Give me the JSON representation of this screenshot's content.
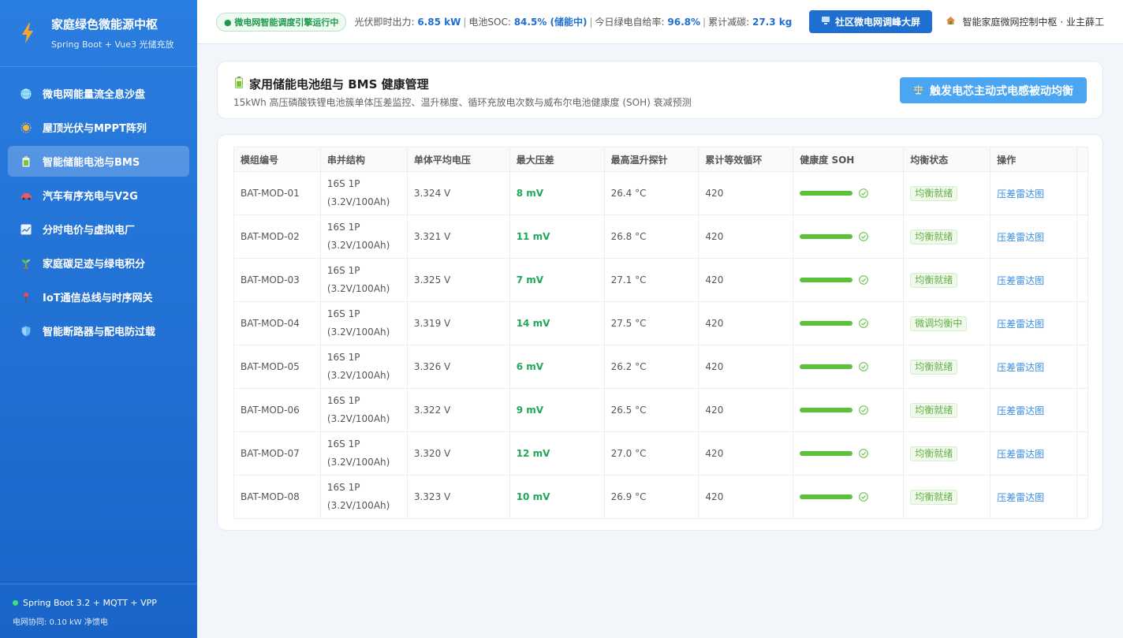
{
  "brand": {
    "title": "家庭绿色微能源中枢",
    "subtitle": "Spring Boot + Vue3 光储充放"
  },
  "nav": [
    {
      "label": "微电网能量流全息沙盘",
      "icon": "globe-icon",
      "active": false
    },
    {
      "label": "屋顶光伏与MPPT阵列",
      "icon": "sun-icon",
      "active": false
    },
    {
      "label": "智能储能电池与BMS",
      "icon": "battery-icon",
      "active": true
    },
    {
      "label": "汽车有序充电与V2G",
      "icon": "car-icon",
      "active": false
    },
    {
      "label": "分时电价与虚拟电厂",
      "icon": "chart-icon",
      "active": false
    },
    {
      "label": "家庭碳足迹与绿电积分",
      "icon": "sprout-icon",
      "active": false
    },
    {
      "label": "IoT通信总线与时序网关",
      "icon": "pin-icon",
      "active": false
    },
    {
      "label": "智能断路器与配电防过载",
      "icon": "shield-icon",
      "active": false
    }
  ],
  "footer": {
    "stack": "Spring Boot 3.2 + MQTT + VPP",
    "grid": "电网协同: 0.10 kW 净馈电"
  },
  "topbar": {
    "status": "● 微电网智能调度引擎运行中",
    "pv_label": "光伏即时出力:",
    "pv_value": "6.85 kW",
    "soc_label": "电池SOC:",
    "soc_value": "84.5% (储能中)",
    "green_label": "今日绿电自给率:",
    "green_value": "96.8%",
    "carbon_label": "累计减碳:",
    "carbon_value": "27.3 kg",
    "screen_button": "社区微电网调峰大屏",
    "user": "智能家庭微网控制中枢 · 业主薛工"
  },
  "header": {
    "title": "家用储能电池组与 BMS 健康管理",
    "subtitle": "15kWh 高压磷酸铁锂电池簇单体压差监控、温升梯度、循环充放电次数与威布尔电池健康度 (SOH) 衰减预测",
    "balance_button": "触发电芯主动式电感被动均衡"
  },
  "table": {
    "headers": [
      "模组编号",
      "串并结构",
      "单体平均电压",
      "最大压差",
      "最高温升探针",
      "累计等效循环",
      "健康度 SOH",
      "均衡状态",
      "操作"
    ],
    "rows": [
      {
        "id": "BAT-MOD-01",
        "s1": "16S 1P",
        "s2": "(3.2V/100Ah)",
        "voltage": "3.324 V",
        "diff": "8 mV",
        "temp": "26.4 °C",
        "cycles": "420",
        "soh": 1.0,
        "status": "均衡就绪",
        "action": "压差雷达图"
      },
      {
        "id": "BAT-MOD-02",
        "s1": "16S 1P",
        "s2": "(3.2V/100Ah)",
        "voltage": "3.321 V",
        "diff": "11 mV",
        "temp": "26.8 °C",
        "cycles": "420",
        "soh": 1.0,
        "status": "均衡就绪",
        "action": "压差雷达图"
      },
      {
        "id": "BAT-MOD-03",
        "s1": "16S 1P",
        "s2": "(3.2V/100Ah)",
        "voltage": "3.325 V",
        "diff": "7 mV",
        "temp": "27.1 °C",
        "cycles": "420",
        "soh": 1.0,
        "status": "均衡就绪",
        "action": "压差雷达图"
      },
      {
        "id": "BAT-MOD-04",
        "s1": "16S 1P",
        "s2": "(3.2V/100Ah)",
        "voltage": "3.319 V",
        "diff": "14 mV",
        "temp": "27.5 °C",
        "cycles": "420",
        "soh": 1.0,
        "status": "微调均衡中",
        "action": "压差雷达图"
      },
      {
        "id": "BAT-MOD-05",
        "s1": "16S 1P",
        "s2": "(3.2V/100Ah)",
        "voltage": "3.326 V",
        "diff": "6 mV",
        "temp": "26.2 °C",
        "cycles": "420",
        "soh": 1.0,
        "status": "均衡就绪",
        "action": "压差雷达图"
      },
      {
        "id": "BAT-MOD-06",
        "s1": "16S 1P",
        "s2": "(3.2V/100Ah)",
        "voltage": "3.322 V",
        "diff": "9 mV",
        "temp": "26.5 °C",
        "cycles": "420",
        "soh": 1.0,
        "status": "均衡就绪",
        "action": "压差雷达图"
      },
      {
        "id": "BAT-MOD-07",
        "s1": "16S 1P",
        "s2": "(3.2V/100Ah)",
        "voltage": "3.320 V",
        "diff": "12 mV",
        "temp": "27.0 °C",
        "cycles": "420",
        "soh": 1.0,
        "status": "均衡就绪",
        "action": "压差雷达图"
      },
      {
        "id": "BAT-MOD-08",
        "s1": "16S 1P",
        "s2": "(3.2V/100Ah)",
        "voltage": "3.323 V",
        "diff": "10 mV",
        "temp": "26.9 °C",
        "cycles": "420",
        "soh": 1.0,
        "status": "均衡就绪",
        "action": "压差雷达图"
      }
    ]
  },
  "colors": {
    "sidebar": "#1f6fd1",
    "accent": "#1f6fd1",
    "success": "#1fa85a",
    "soh_bar": "#5cc03b"
  }
}
